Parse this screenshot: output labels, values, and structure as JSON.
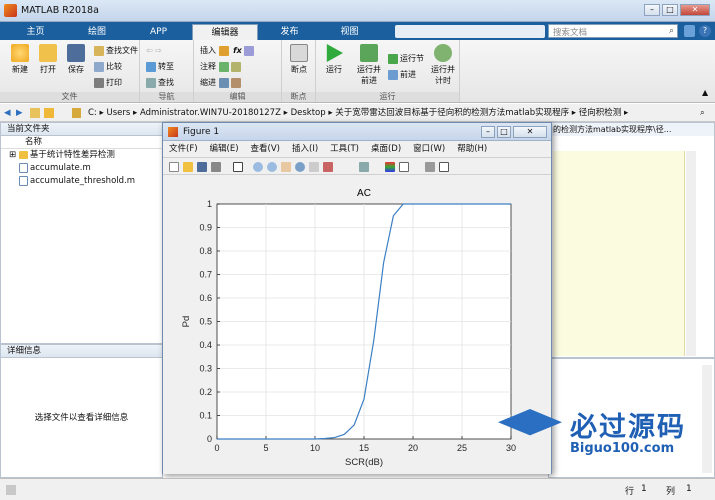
{
  "app": {
    "title": "MATLAB R2018a"
  },
  "tabs": [
    "主页",
    "绘图",
    "APP",
    "编辑器",
    "发布",
    "视图"
  ],
  "search": {
    "placeholder": "搜索文档"
  },
  "ribbon": {
    "file": {
      "new": "新建",
      "open": "打开",
      "save": "保存",
      "find_files": "查找文件",
      "compare": "比较",
      "print": "打印",
      "label": "文件"
    },
    "nav": {
      "goto": "转至",
      "find": "查找",
      "label": "导航"
    },
    "edit": {
      "insert": "插入",
      "comment": "注释",
      "indent": "缩进",
      "label": "编辑"
    },
    "breakpoints": {
      "btn": "断点",
      "label": "断点"
    },
    "run": {
      "run": "运行",
      "run_advance": "运行并\n前进",
      "run_section": "运行节",
      "advance": "前进",
      "run_time": "运行并\n计时",
      "label": "运行"
    }
  },
  "path": [
    "C:",
    "Users",
    "Administrator.WIN7U-20180127Z",
    "Desktop",
    "关于宽带雷达回波目标基于径向积的检测方法matlab实现程序",
    "径向积检测"
  ],
  "filepane": {
    "title": "当前文件夹",
    "col": "名称",
    "items": [
      "基于统计特性差异检测",
      "accumulate.m",
      "accumulate_threshold.m"
    ]
  },
  "details": {
    "title": "详细信息",
    "msg": "选择文件以查看详细信息"
  },
  "editor_tail": "的检测方法matlab实现程序\\径...",
  "figure": {
    "title": "Figure 1",
    "menus": [
      "文件(F)",
      "编辑(E)",
      "查看(V)",
      "插入(I)",
      "工具(T)",
      "桌面(D)",
      "窗口(W)",
      "帮助(H)"
    ]
  },
  "chart_data": {
    "type": "line",
    "title": "AC",
    "xlabel": "SCR(dB)",
    "ylabel": "Pd",
    "xlim": [
      0,
      30
    ],
    "ylim": [
      0,
      1
    ],
    "xticks": [
      0,
      5,
      10,
      15,
      20,
      25,
      30
    ],
    "yticks": [
      0,
      0.1,
      0.2,
      0.3,
      0.4,
      0.5,
      0.6,
      0.7,
      0.8,
      0.9,
      1
    ],
    "grid": true,
    "series": [
      {
        "color": "#3b7fc4",
        "x": [
          0,
          5,
          10,
          11,
          12,
          13,
          14,
          15,
          16,
          17,
          18,
          19,
          20,
          21,
          22,
          25,
          30
        ],
        "y": [
          0,
          0,
          0,
          0.002,
          0.006,
          0.02,
          0.06,
          0.17,
          0.42,
          0.75,
          0.95,
          1,
          1,
          1,
          1,
          1,
          1
        ]
      }
    ]
  },
  "statusbar": {
    "row_label": "行",
    "row": "1",
    "col_label": "列",
    "col": "1"
  },
  "watermark": {
    "brand": "必过源码",
    "url": "Biguo100.com"
  }
}
